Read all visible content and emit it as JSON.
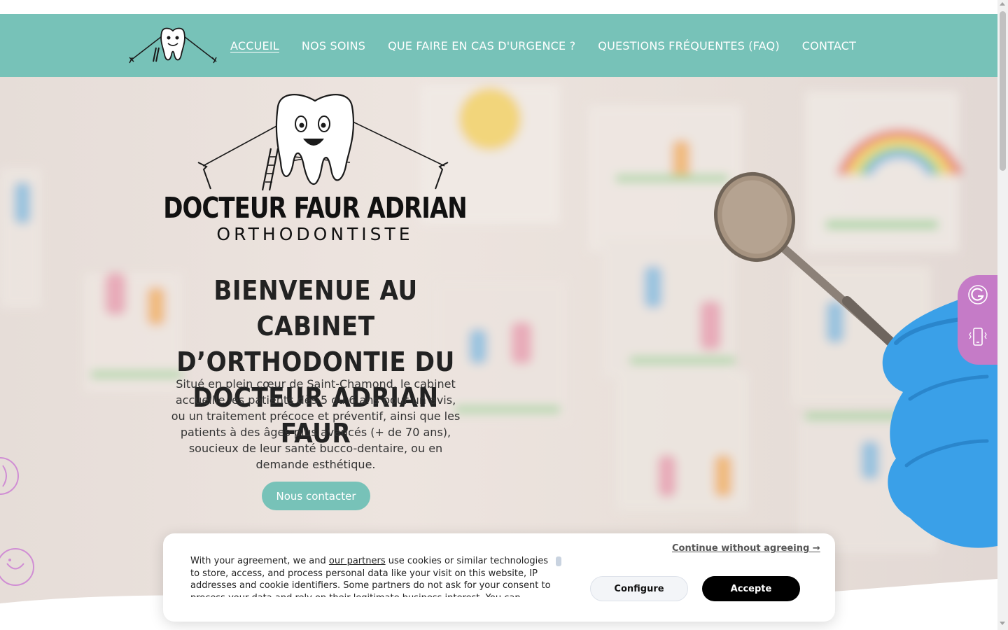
{
  "header": {
    "logo_alt": "Docteur Faur Adrian logo",
    "nav": [
      {
        "label": "ACCUEIL",
        "active": true
      },
      {
        "label": "NOS SOINS",
        "active": false
      },
      {
        "label": "QUE FAIRE EN CAS D'URGENCE ?",
        "active": false
      },
      {
        "label": "QUESTIONS FRÉQUENTES (FAQ)",
        "active": false
      },
      {
        "label": "CONTACT",
        "active": false
      }
    ]
  },
  "hero": {
    "brand_name": "DOCTEUR FAUR ADRIAN",
    "brand_sub": "ORTHODONTISTE",
    "title": "BIENVENUE AU CABINET D’ORTHODONTIE DU DOCTEUR ADRIAN FAUR",
    "text": "Situé en plein cœur de Saint-Chamond, le cabinet accueille les patients dès 5 ou 6 ans pour un avis, ou un traitement précoce et préventif, ainsi que les patients à des âges plus avancés (+ de 70 ans), soucieux de leur santé bucco-dentaire, ou en demande esthétique.",
    "cta_label": "Nous contacter"
  },
  "side_widgets": {
    "icons": [
      "google-icon",
      "phone-icon"
    ],
    "color": "#c57bc7"
  },
  "cookie": {
    "text_before": "With your agreement, we and ",
    "partners_link": "our partners",
    "text_after": " use cookies or similar technologies to store, access, and process personal data like your visit on this website, IP addresses and cookie identifiers. Some partners do not ask for your consent to process your data and rely on their legitimate business interest. You can",
    "continue_label": "Continue without agreeing →",
    "configure_label": "Configure",
    "accept_label": "Accepte"
  },
  "colors": {
    "brand_teal": "#77c2b8",
    "side_purple": "#c57bc7",
    "glove_blue": "#3aa0e8"
  }
}
